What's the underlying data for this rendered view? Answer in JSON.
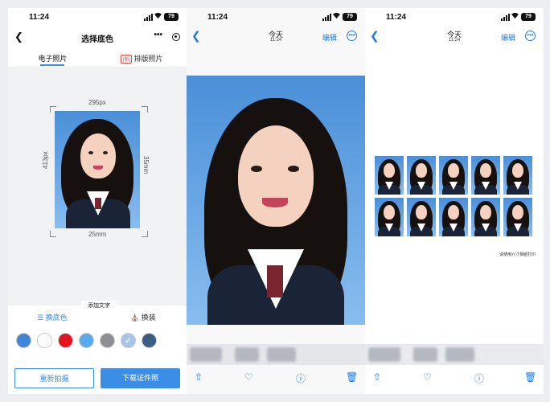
{
  "status": {
    "time": "11:24",
    "battery": "79"
  },
  "editor": {
    "title": "选择底色",
    "tabs": [
      "电子照片",
      "排版照片"
    ],
    "tab_badge": "(新)",
    "width_label": "295px",
    "height_label_left": "413px",
    "height_label_right": "35mm",
    "bottom_label": "25mm",
    "add_text": "添加文字",
    "tool_bg": "换底色",
    "tool_outfit": "换装",
    "colors": [
      "#3f86d6",
      "#ffffff",
      "#e3141b",
      "#5aaaf0",
      "#8d8f92",
      "#a7c5ea",
      "#3a5e86"
    ],
    "selected_color_index": 5,
    "retake": "重新拍摄",
    "download": "下载证件照"
  },
  "viewer1": {
    "date": "今天",
    "time": "11:24",
    "edit": "编辑"
  },
  "viewer2": {
    "date": "今天",
    "time": "11:24",
    "edit": "编辑",
    "note": "请使用六寸相纸打印"
  }
}
